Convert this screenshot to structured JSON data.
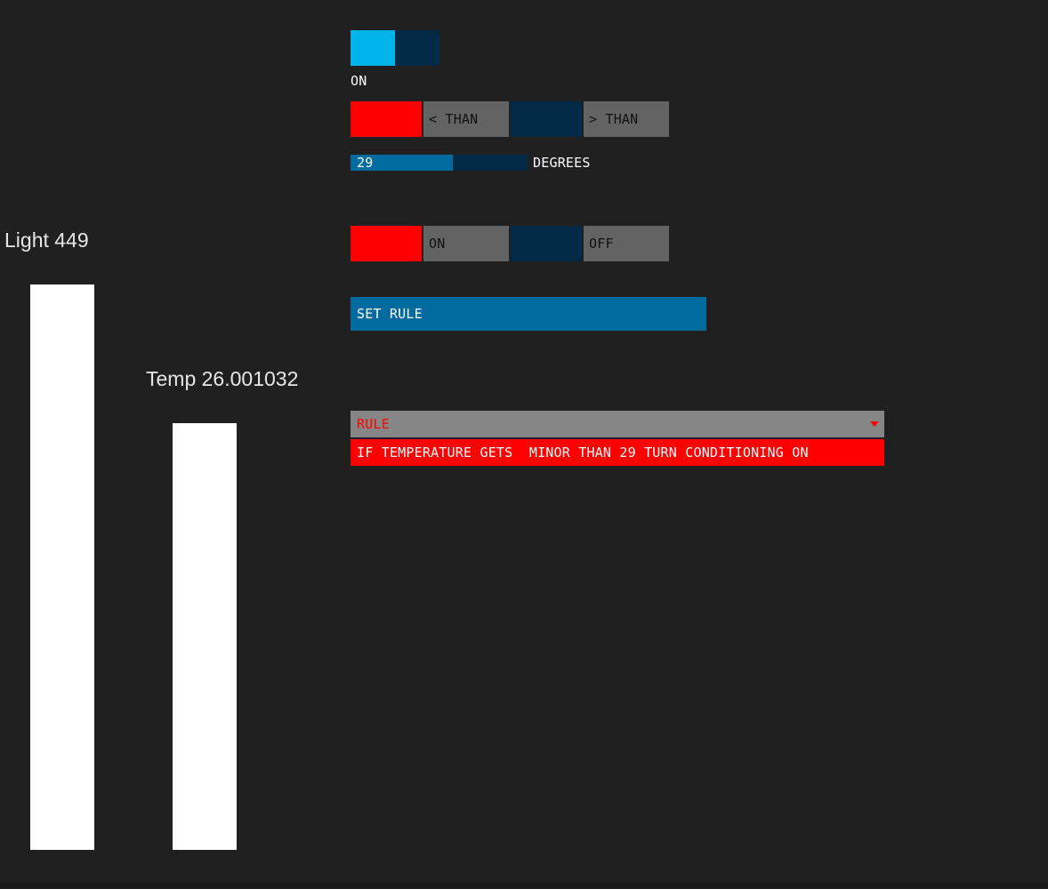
{
  "sensors": {
    "light_label": "Light 449",
    "temp_label": "Temp 26.001032",
    "light_value": 449,
    "temp_value": 26.001032
  },
  "toggle": {
    "label": "ON",
    "state": "on"
  },
  "comparison": {
    "selected": "less_than",
    "options": [
      "< THAN",
      "> THAN"
    ]
  },
  "threshold": {
    "value_label": "29",
    "value": 29,
    "min": 0,
    "max": 50,
    "caption": "DEGREES"
  },
  "action": {
    "selected": "on",
    "options": [
      "ON",
      "OFF"
    ]
  },
  "set_rule_button": {
    "label": "SET RULE"
  },
  "rule_dropdown": {
    "label": "RULE",
    "items": [
      "IF TEMPERATURE GETS  MINOR THAN 29 TURN CONDITIONING ON"
    ]
  },
  "colors": {
    "background": "#202020",
    "active_toggle": "#00b4ea",
    "inactive_dark": "#022a46",
    "selected_red": "#ff0000",
    "option_grey": "#636363",
    "accent_blue": "#006b9e",
    "dropdown_grey": "#868686"
  }
}
